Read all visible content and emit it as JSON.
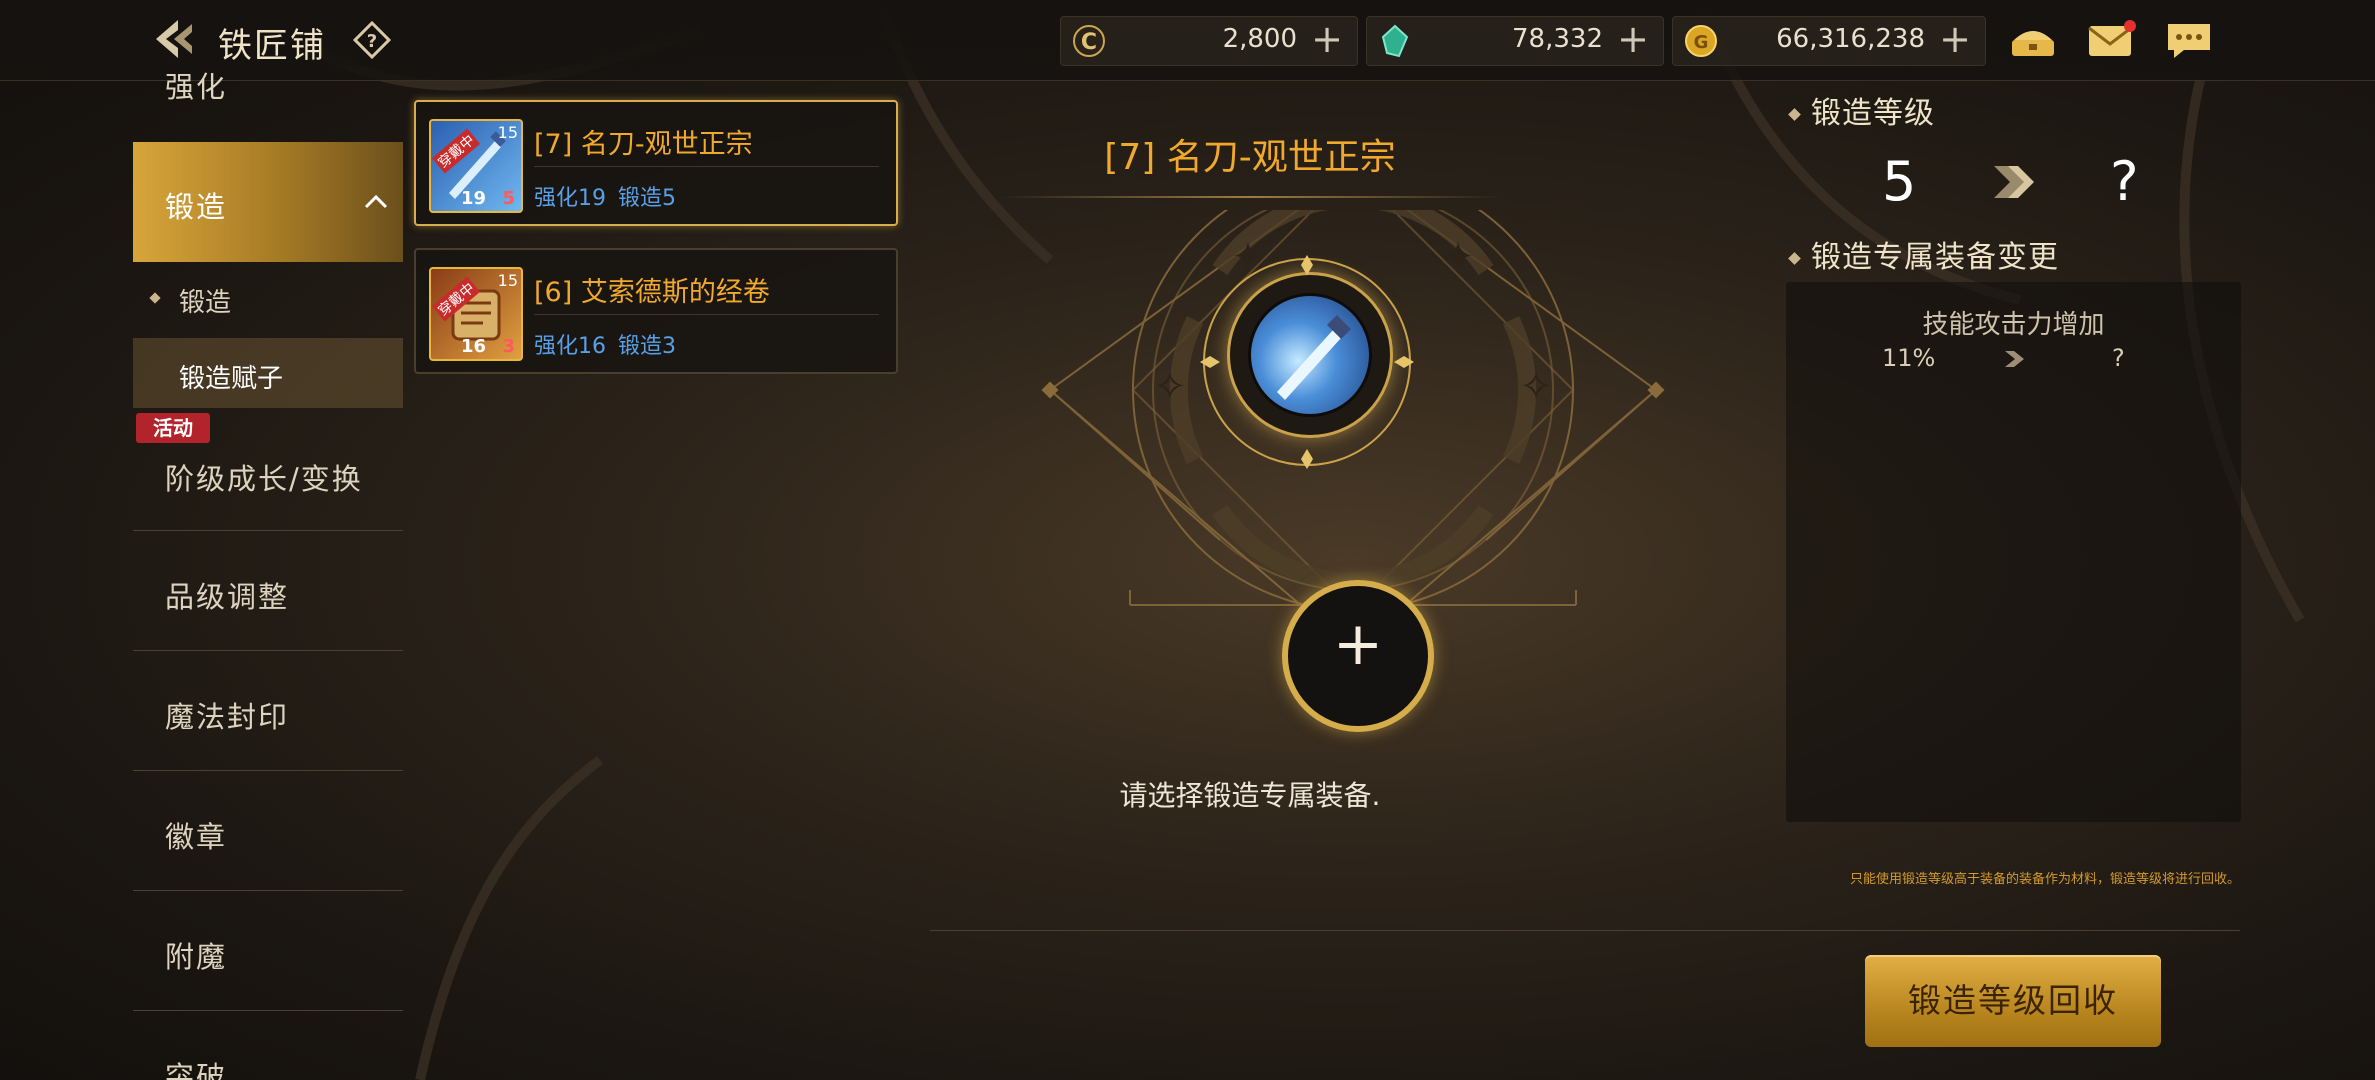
{
  "header": {
    "title": "铁匠铺",
    "help": "?"
  },
  "currencies": [
    {
      "name": "coin-c",
      "value": "2,800",
      "plus": "+"
    },
    {
      "name": "gem",
      "value": "78,332",
      "plus": "+"
    },
    {
      "name": "gold",
      "value": "66,316,238",
      "plus": "+"
    }
  ],
  "sidebar": {
    "items": [
      {
        "label": "强化"
      },
      {
        "label": "锻造"
      },
      {
        "label": "阶级成长/变换"
      },
      {
        "label": "品级调整"
      },
      {
        "label": "魔法封印"
      },
      {
        "label": "徽章"
      },
      {
        "label": "附魔"
      },
      {
        "label": "突破"
      }
    ],
    "subitems": [
      {
        "label": "锻造"
      },
      {
        "label": "锻造赋子"
      }
    ],
    "event_badge": "活动"
  },
  "equipment_list": [
    {
      "name": "[7]  名刀-观世正宗",
      "enhance": "强化19",
      "forge": "锻造5",
      "level": "15",
      "thumb_label": "穿戴中",
      "thumb_stats": "19",
      "thumb_stats2": "5",
      "selected": true
    },
    {
      "name": "[6]  艾索德斯的经卷",
      "enhance": "强化16",
      "forge": "锻造3",
      "level": "15",
      "thumb_label": "穿戴中",
      "thumb_stats": "16",
      "thumb_stats2": "3",
      "selected": false
    }
  ],
  "center": {
    "item_title": "[7]  名刀-观世正宗",
    "add_symbol": "+",
    "prompt": "请选择锻造专属装备."
  },
  "right": {
    "forge_level_title": "锻造等级",
    "current_level": "5",
    "next_level": "?",
    "change_title": "锻造专属装备变更",
    "stat_name": "技能攻击力增加",
    "stat_current": "11%",
    "stat_next": "?",
    "note": "只能使用锻造等级高于装备的装备作为材料，锻造等级将进行回收。",
    "recall_button": "锻造等级回收"
  },
  "colors": {
    "accent": "#f0a92d",
    "stat_blue": "#5aa0e8",
    "button_gold": "#c9962a"
  }
}
